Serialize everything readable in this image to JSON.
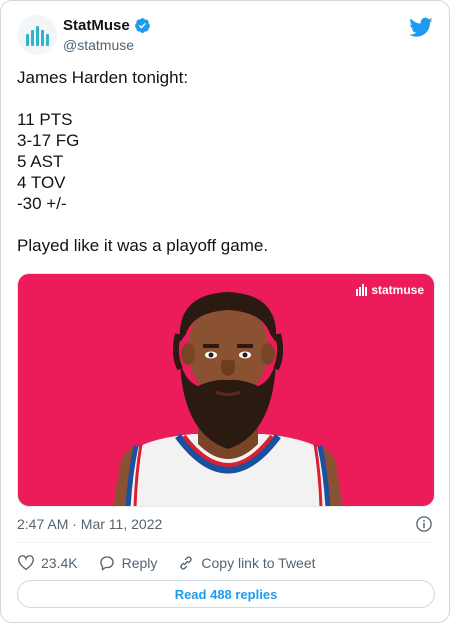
{
  "author": {
    "name": "StatMuse",
    "handle": "@statmuse",
    "verified": true
  },
  "tweet": {
    "text": "James Harden tonight:\n\n11 PTS\n3-17 FG\n5 AST\n4 TOV\n-30 +/-\n\nPlayed like it was a playoff game."
  },
  "media": {
    "brand_text": "statmuse",
    "background": "#ec1c5a"
  },
  "meta": {
    "timestamp": "2:47 AM · Mar 11, 2022"
  },
  "actions": {
    "likes": "23.4K",
    "reply_label": "Reply",
    "copy_link_label": "Copy link to Tweet"
  },
  "read_replies": "Read 488 replies",
  "colors": {
    "twitter_blue": "#1d9bf0",
    "text_primary": "#0f1419",
    "text_secondary": "#536471"
  }
}
